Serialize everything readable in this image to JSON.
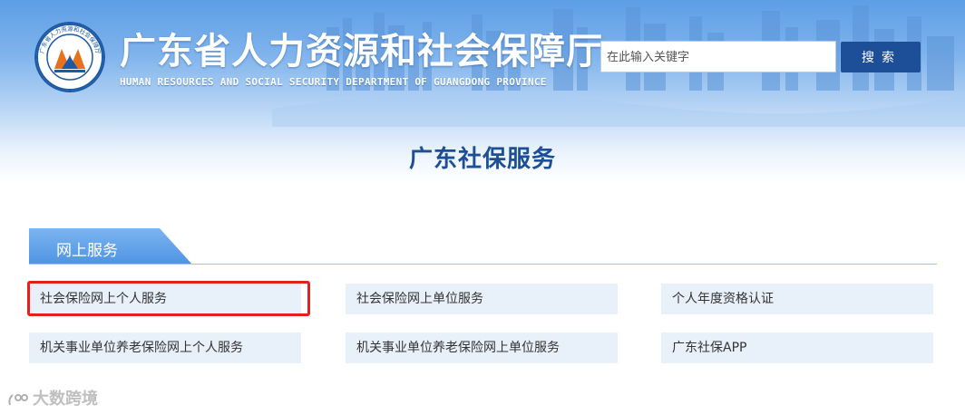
{
  "header": {
    "emblem_text": "广东省人力资源和社会保障厅",
    "title": "广东省人力资源和社会保障厅",
    "subtitle": "HUMAN RESOURCES AND SOCIAL SECURITY DEPARTMENT OF GUANGDONG PROVINCE",
    "search": {
      "placeholder": "在此输入关键字",
      "value": "",
      "button_label": "搜索"
    }
  },
  "page": {
    "title": "广东社保服务"
  },
  "section": {
    "tab_label": "网上服务",
    "items": [
      {
        "label": "社会保险网上个人服务",
        "highlighted": true
      },
      {
        "label": "社会保险网上单位服务"
      },
      {
        "label": "个人年度资格认证"
      },
      {
        "label": "机关事业单位养老保险网上个人服务"
      },
      {
        "label": "机关事业单位养老保险网上单位服务"
      },
      {
        "label": "广东社保APP"
      }
    ]
  },
  "watermark": {
    "text": "大数跨境",
    "icon": "watermark-logo-icon"
  },
  "colors": {
    "brand_blue": "#1c4f97",
    "tab_blue": "#5a9de6",
    "item_bg": "#e8f0fa",
    "highlight_red": "#e3201b"
  }
}
